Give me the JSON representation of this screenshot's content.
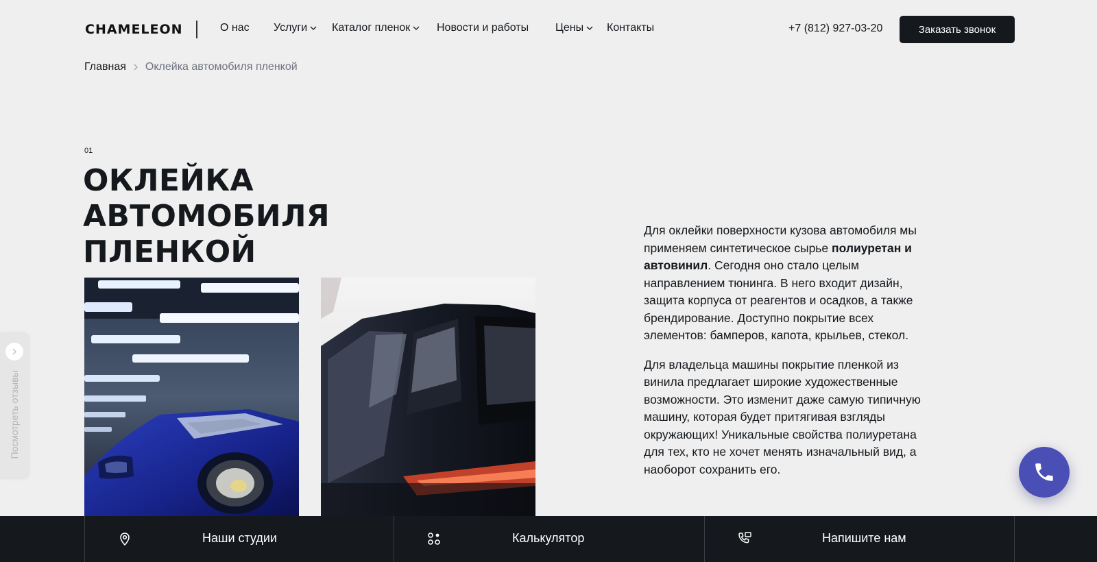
{
  "header": {
    "logo": "CHAMELEON",
    "nav": [
      {
        "label": "О нас",
        "has_dropdown": false
      },
      {
        "label": "Услуги",
        "has_dropdown": true
      },
      {
        "label": "Каталог пленок",
        "has_dropdown": true
      },
      {
        "label": "Новости и работы",
        "has_dropdown": false
      },
      {
        "label": "Цены",
        "has_dropdown": true
      },
      {
        "label": "Контакты",
        "has_dropdown": false
      }
    ],
    "phone": "+7 (812) 927-03-20",
    "callback_button": "Заказать звонок"
  },
  "breadcrumb": {
    "home": "Главная",
    "current": "Оклейка автомобиля пленкой"
  },
  "section": {
    "number": "01",
    "title_line1": "ОКЛЕЙКА АВТОМОБИЛЯ",
    "title_line2": "ПЛЕНКОЙ"
  },
  "description": {
    "p1_part1": "Для оклейки поверхности кузова автомобиля мы применяем синтетическое сырье ",
    "p1_bold": "полиуретан и автовинил",
    "p1_part2": ". Сегодня оно стало целым направлением тюнинга. В него входит дизайн, защита корпуса от реагентов и осадков, а также брендирование. Доступно покрытие всех элементов: бамперов, капота, крыльев, стекол.",
    "p2": "Для владельца машины покрытие пленкой из винила предлагает широкие художественные возможности. Это изменит даже самую типичную машину, которая будет притягивая взгляды окружающих! Уникальные свойства полиуретана для тех, кто не хочет менять изначальный вид, а наоборот сохранить его."
  },
  "reviews_tab": {
    "label": "Посмотреть отзывы"
  },
  "bottom_bar": {
    "items": [
      {
        "label": "Наши студии",
        "icon": "map-pin-icon"
      },
      {
        "label": "Калькулятор",
        "icon": "grid-dots-icon"
      },
      {
        "label": "Напишите нам",
        "icon": "phone-message-icon"
      }
    ]
  },
  "colors": {
    "background": "#efefef",
    "dark": "#15191d",
    "accent_fab": "#4a4fb5",
    "muted_text": "#6f7280"
  }
}
